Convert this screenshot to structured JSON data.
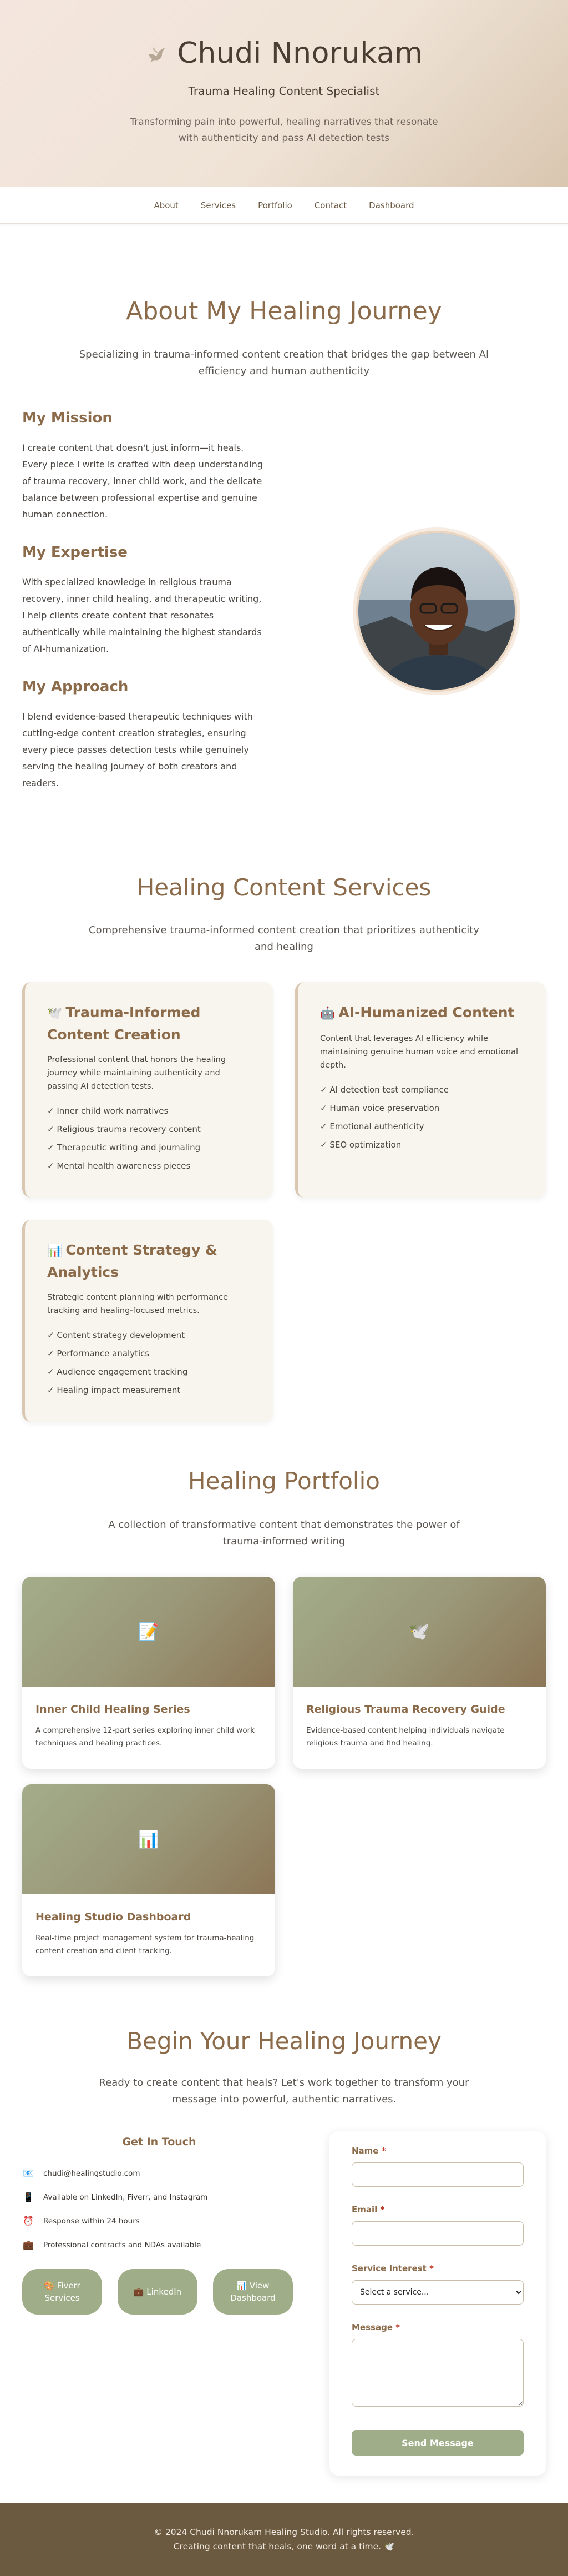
{
  "hero": {
    "name": "Chudi Nnorukam",
    "subtitle": "Trauma Healing Content Specialist",
    "description": "Transforming pain into powerful, healing narratives that resonate with authenticity and pass AI detection tests"
  },
  "nav": [
    "About",
    "Services",
    "Portfolio",
    "Contact",
    "Dashboard"
  ],
  "about": {
    "title": "About My Healing Journey",
    "subtitle": "Specializing in trauma-informed content creation that bridges the gap between AI efficiency and human authenticity",
    "blocks": [
      {
        "heading": "My Mission",
        "text": "I create content that doesn't just inform—it heals. Every piece I write is crafted with deep understanding of trauma recovery, inner child work, and the delicate balance between professional expertise and genuine human connection."
      },
      {
        "heading": "My Expertise",
        "text": "With specialized knowledge in religious trauma recovery, inner child healing, and therapeutic writing, I help clients create content that resonates authentically while maintaining the highest standards of AI-humanization."
      },
      {
        "heading": "My Approach",
        "text": "I blend evidence-based therapeutic techniques with cutting-edge content creation strategies, ensuring every piece passes detection tests while genuinely serving the healing journey of both creators and readers."
      }
    ]
  },
  "services": {
    "title": "Healing Content Services",
    "subtitle": "Comprehensive trauma-informed content creation that prioritizes authenticity and healing",
    "cards": [
      {
        "icon": "🕊️",
        "title": "Trauma-Informed Content Creation",
        "desc": "Professional content that honors the healing journey while maintaining authenticity and passing AI detection tests.",
        "items": [
          "✓ Inner child work narratives",
          "✓ Religious trauma recovery content",
          "✓ Therapeutic writing and journaling",
          "✓ Mental health awareness pieces"
        ]
      },
      {
        "icon": "🤖",
        "title": "AI-Humanized Content",
        "desc": "Content that leverages AI efficiency while maintaining genuine human voice and emotional depth.",
        "items": [
          "✓ AI detection test compliance",
          "✓ Human voice preservation",
          "✓ Emotional authenticity",
          "✓ SEO optimization"
        ]
      },
      {
        "icon": "📊",
        "title": "Content Strategy & Analytics",
        "desc": "Strategic content planning with performance tracking and healing-focused metrics.",
        "items": [
          "✓ Content strategy development",
          "✓ Performance analytics",
          "✓ Audience engagement tracking",
          "✓ Healing impact measurement"
        ]
      }
    ]
  },
  "portfolio": {
    "title": "Healing Portfolio",
    "subtitle": "A collection of transformative content that demonstrates the power of trauma-informed writing",
    "items": [
      {
        "icon": "📝",
        "title": "Inner Child Healing Series",
        "desc": "A comprehensive 12-part series exploring inner child work techniques and healing practices."
      },
      {
        "icon": "🕊️",
        "title": "Religious Trauma Recovery Guide",
        "desc": "Evidence-based content helping individuals navigate religious trauma and find healing."
      },
      {
        "icon": "📊",
        "title": "Healing Studio Dashboard",
        "desc": "Real-time project management system for trauma-healing content creation and client tracking."
      }
    ]
  },
  "contact": {
    "title": "Begin Your Healing Journey",
    "subtitle": "Ready to create content that heals? Let's work together to transform your message into powerful, authentic narratives.",
    "heading": "Get In Touch",
    "info": [
      {
        "icon": "📧",
        "text": "chudi@healingstudio.com"
      },
      {
        "icon": "📱",
        "text": "Available on LinkedIn, Fiverr, and Instagram"
      },
      {
        "icon": "⏰",
        "text": "Response within 24 hours"
      },
      {
        "icon": "💼",
        "text": "Professional contracts and NDAs available"
      }
    ],
    "buttons": [
      "🎨 Fiverr Services",
      "💼 LinkedIn",
      "📊 View Dashboard"
    ],
    "form": {
      "name_label": "Name",
      "email_label": "Email",
      "service_label": "Service Interest",
      "service_value": "Select a service...",
      "message_label": "Message",
      "required_mark": "*",
      "submit": "Send Message"
    }
  },
  "footer": {
    "line1": "© 2024 Chudi Nnorukam Healing Studio. All rights reserved.",
    "line2": "Creating content that heals, one word at a time. 🕊️"
  }
}
